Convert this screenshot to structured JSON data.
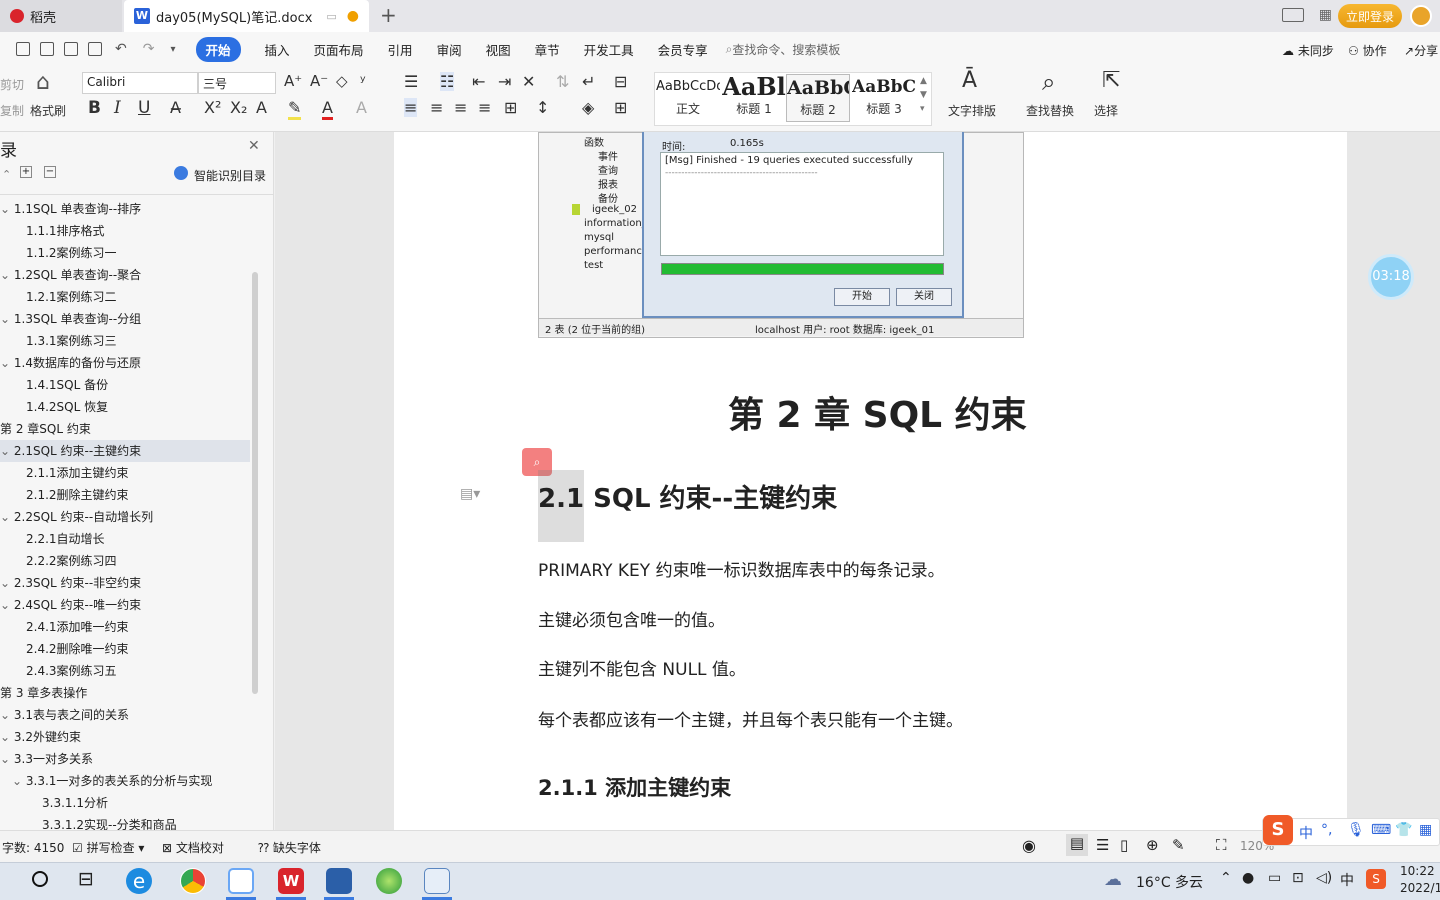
{
  "titlebar": {
    "home_tab": "稻壳",
    "doc_tab": "day05(MySQL)笔记.docx",
    "new_tab": "+",
    "login": "立即登录"
  },
  "menubar": {
    "items": [
      "开始",
      "插入",
      "页面布局",
      "引用",
      "审阅",
      "视图",
      "章节",
      "开发工具",
      "会员专享"
    ],
    "search": "查找命令、搜索模板",
    "unsync": "未同步",
    "collab": "协作",
    "share": "分享"
  },
  "ribbon": {
    "cut": "剪切",
    "copy": "复制",
    "format_painter": "格式刷",
    "font": "Calibri",
    "size": "三号",
    "styles": [
      {
        "preview": "AaBbCcDd",
        "label": "正文"
      },
      {
        "preview": "AaBl",
        "label": "标题 1"
      },
      {
        "preview": "AaBbC",
        "label": "标题 2"
      },
      {
        "preview": "AaBbC",
        "label": "标题 3"
      }
    ],
    "text_layout": "文字排版",
    "find_replace": "查找替换",
    "select": "选择"
  },
  "sidebar": {
    "title": "录",
    "smart_toc": "智能识别目录",
    "items": [
      {
        "label": "1.1SQL 单表查询--排序",
        "level": 1
      },
      {
        "label": "1.1.1排序格式",
        "level": 2
      },
      {
        "label": "1.1.2案例练习一",
        "level": 2
      },
      {
        "label": "1.2SQL 单表查询--聚合",
        "level": 1
      },
      {
        "label": "1.2.1案例练习二",
        "level": 2
      },
      {
        "label": "1.3SQL 单表查询--分组",
        "level": 1
      },
      {
        "label": "1.3.1案例练习三",
        "level": 2
      },
      {
        "label": "1.4数据库的备份与还原",
        "level": 1
      },
      {
        "label": "1.4.1SQL 备份",
        "level": 2
      },
      {
        "label": "1.4.2SQL 恢复",
        "level": 2
      },
      {
        "label": "第 2 章SQL 约束",
        "level": 0
      },
      {
        "label": "2.1SQL 约束--主键约束",
        "level": 1
      },
      {
        "label": "2.1.1添加主键约束",
        "level": 2
      },
      {
        "label": "2.1.2删除主键约束",
        "level": 2
      },
      {
        "label": "2.2SQL 约束--自动增长列",
        "level": 1
      },
      {
        "label": "2.2.1自动增长",
        "level": 2
      },
      {
        "label": "2.2.2案例练习四",
        "level": 2
      },
      {
        "label": "2.3SQL 约束--非空约束",
        "level": 1
      },
      {
        "label": "2.4SQL 约束--唯一约束",
        "level": 1
      },
      {
        "label": "2.4.1添加唯一约束",
        "level": 2
      },
      {
        "label": "2.4.2删除唯一约束",
        "level": 2
      },
      {
        "label": "2.4.3案例练习五",
        "level": 2
      },
      {
        "label": "第 3 章多表操作",
        "level": 0
      },
      {
        "label": "3.1表与表之间的关系",
        "level": 1
      },
      {
        "label": "3.2外键约束",
        "level": 1
      },
      {
        "label": "3.3一对多关系",
        "level": 1
      },
      {
        "label": "3.3.1一对多的表关系的分析与实现",
        "level": 2
      },
      {
        "label": "3.3.1.1分析",
        "level": 3
      },
      {
        "label": "3.3.1.2实现--分类和商品",
        "level": 3
      }
    ]
  },
  "screenshot": {
    "tree": [
      "函数",
      "事件",
      "查询",
      "报表",
      "备份",
      "igeek_02",
      "information_",
      "mysql",
      "performance",
      "test"
    ],
    "time_label": "时间:",
    "time_value": "0.165s",
    "msg": "[Msg] Finished - 19 queries executed successfully",
    "dashes": "-----------------------------------------------",
    "start_btn": "开始",
    "close_btn": "关闭",
    "status_left": "2 表 (2 位于当前的组)",
    "status_right": "localhost  用户: root  数据库: igeek_01"
  },
  "document": {
    "chapter": "第 2 章  SQL 约束",
    "section": "2.1 SQL 约束--主键约束",
    "paragraphs": [
      "PRIMARY KEY  约束唯一标识数据库表中的每条记录。",
      "主键必须包含唯一的值。",
      "主键列不能包含  NULL  值。",
      "每个表都应该有一个主键，并且每个表只能有一个主键。"
    ],
    "subsection": "2.1.1 添加主键约束"
  },
  "timer": "03:18",
  "statusbar": {
    "word_count": "字数: 4150",
    "spell_check": "拼写检查",
    "doc_check": "文档校对",
    "missing_font": "缺失字体",
    "zoom": "120%"
  },
  "ime": {
    "lang": "中"
  },
  "taskbar": {
    "weather": "16°C 多云",
    "time": "10:22",
    "date": "2022/1"
  }
}
